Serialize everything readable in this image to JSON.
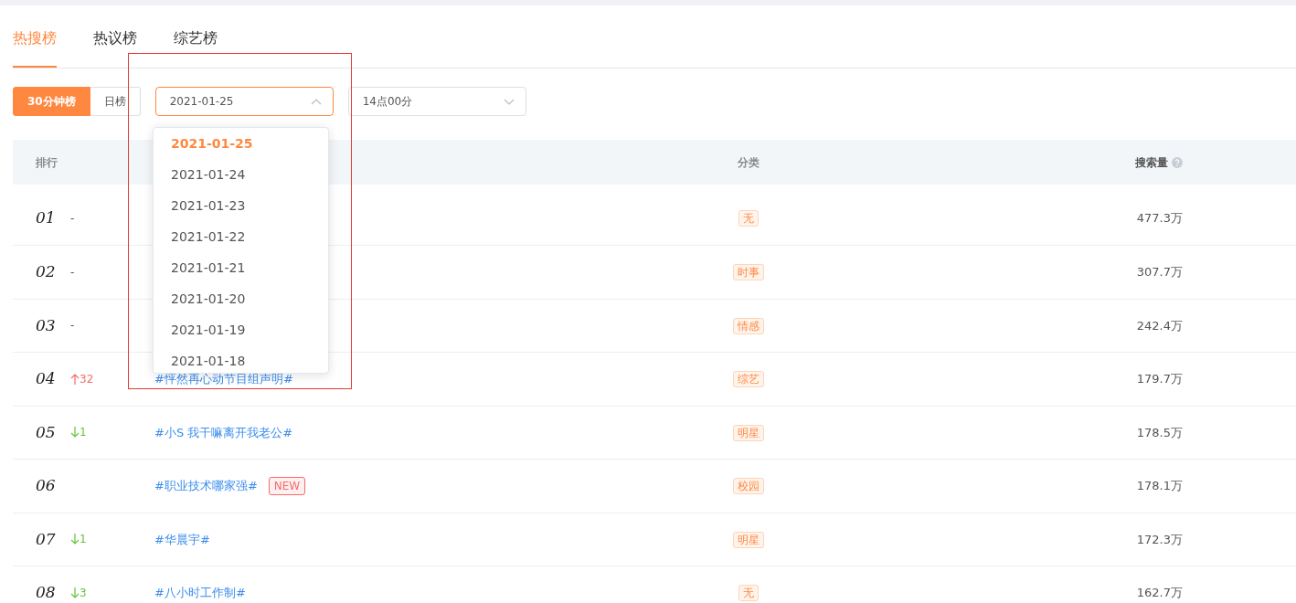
{
  "tabs": [
    {
      "label": "热搜榜",
      "selected": true
    },
    {
      "label": "热议榜",
      "selected": false
    },
    {
      "label": "综艺榜",
      "selected": false
    }
  ],
  "period_toggle": [
    {
      "label": "30分钟榜",
      "selected": true
    },
    {
      "label": "日榜",
      "selected": false
    }
  ],
  "date_select": {
    "value": "2021-01-25",
    "expanded": true
  },
  "time_select": {
    "value": "14点00分",
    "expanded": false
  },
  "date_options": [
    {
      "label": "2021-01-25",
      "selected": true
    },
    {
      "label": "2021-01-24",
      "selected": false
    },
    {
      "label": "2021-01-23",
      "selected": false
    },
    {
      "label": "2021-01-22",
      "selected": false
    },
    {
      "label": "2021-01-21",
      "selected": false
    },
    {
      "label": "2021-01-20",
      "selected": false
    },
    {
      "label": "2021-01-19",
      "selected": false
    },
    {
      "label": "2021-01-18",
      "selected": false
    }
  ],
  "highlight_frame": true,
  "table": {
    "columns": [
      "排行",
      "分类",
      "搜索量"
    ],
    "rows": [
      {
        "rank": "01",
        "trend": {
          "kind": "same",
          "text": "-"
        },
        "category": "无",
        "volume": "477.3万"
      },
      {
        "rank": "02",
        "trend": {
          "kind": "same",
          "text": "-"
        },
        "category": "时事",
        "volume": "307.7万"
      },
      {
        "rank": "03",
        "trend": {
          "kind": "same",
          "text": "-"
        },
        "category": "情感",
        "volume": "242.4万"
      },
      {
        "rank": "04",
        "trend": {
          "kind": "up",
          "text": "32"
        },
        "topic": "#怦然再心动节目组声明#",
        "category": "综艺",
        "volume": "179.7万"
      },
      {
        "rank": "05",
        "trend": {
          "kind": "down",
          "text": "1"
        },
        "topic": "#小S 我干嘛离开我老公#",
        "category": "明星",
        "volume": "178.5万"
      },
      {
        "rank": "06",
        "topic": "#职业技术哪家强#",
        "badge": "NEW",
        "category": "校园",
        "volume": "178.1万"
      },
      {
        "rank": "07",
        "trend": {
          "kind": "down",
          "text": "1"
        },
        "topic": "#华晨宇#",
        "category": "明星",
        "volume": "172.3万"
      },
      {
        "rank": "08",
        "trend": {
          "kind": "down",
          "text": "3"
        },
        "topic": "#八小时工作制#",
        "category": "无",
        "volume": "162.7万"
      }
    ]
  }
}
